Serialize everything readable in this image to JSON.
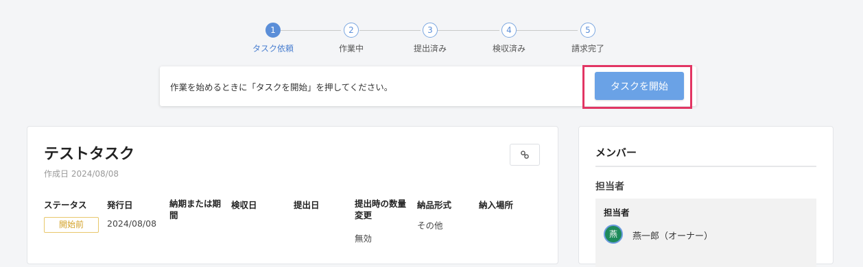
{
  "stepper": {
    "steps": [
      {
        "number": "1",
        "label": "タスク依頼",
        "active": true
      },
      {
        "number": "2",
        "label": "作業中",
        "active": false
      },
      {
        "number": "3",
        "label": "提出済み",
        "active": false
      },
      {
        "number": "4",
        "label": "検収済み",
        "active": false
      },
      {
        "number": "5",
        "label": "請求完了",
        "active": false
      }
    ]
  },
  "notice": {
    "message": "作業を始めるときに「タスクを開始」を押してください。",
    "start_button": "タスクを開始"
  },
  "task": {
    "title": "テストタスク",
    "created": "作成日 2024/08/08",
    "link_icon": "link-icon",
    "columns": {
      "status": "ステータス",
      "issue_date": "発行日",
      "deadline_line1": "納期または期",
      "deadline_line2": "間",
      "inspection_date": "検収日",
      "submit_date": "提出日",
      "qty_change_line1": "提出時の数量",
      "qty_change_line2": "変更",
      "delivery_format": "納品形式",
      "delivery_place": "納入場所"
    },
    "values": {
      "status": "開始前",
      "issue_date": "2024/08/08",
      "qty_change": "無効",
      "delivery_format": "その他"
    }
  },
  "members": {
    "title": "メンバー",
    "section": "担当者",
    "box_header": "担当者",
    "avatar_char": "燕",
    "name": "燕一郎（オーナー）"
  },
  "colors": {
    "accent": "#5b8ed8",
    "button": "#6aa2e6",
    "highlight": "#e23563",
    "badge": "#d3a229",
    "avatar": "#1e8a5a"
  }
}
